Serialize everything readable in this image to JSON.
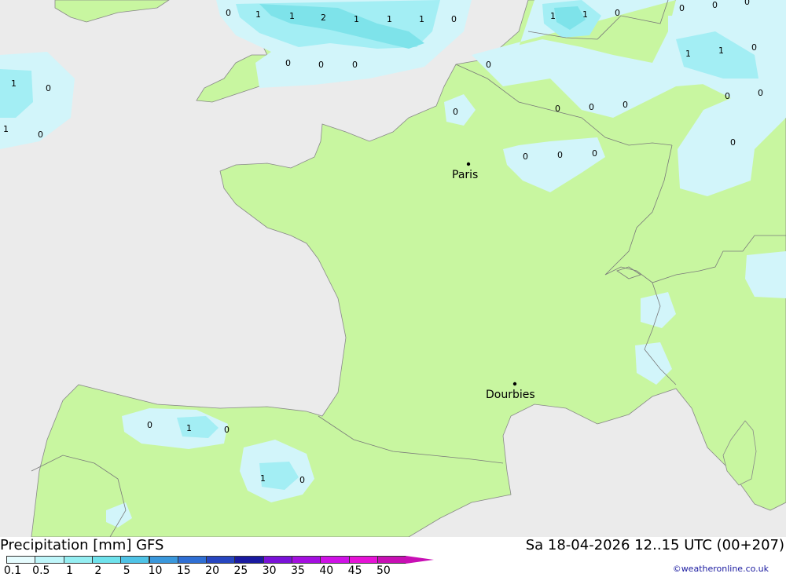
{
  "map": {
    "colors": {
      "sea": "#ebebeb",
      "land": "#c8f6a0",
      "light": "#d2f5fa",
      "mid": "#a3eef4",
      "heavy": "#7ee3ea",
      "border": "#7a7a7a"
    },
    "cities": [
      {
        "name": "Paris",
        "id": "paris"
      },
      {
        "name": "Dourbies",
        "id": "dourbies"
      }
    ],
    "values": [
      "0",
      "1",
      "1",
      "2",
      "1",
      "1",
      "1",
      "0",
      "1",
      "1",
      "0",
      "0",
      "0",
      "0",
      "1",
      "1",
      "0",
      "0",
      "0",
      "0",
      "0",
      "0",
      "0",
      "0",
      "0",
      "0",
      "0",
      "1",
      "0",
      "1",
      "0",
      "0",
      "0",
      "0",
      "0",
      "1",
      "0",
      "1",
      "0",
      "0"
    ]
  },
  "footer": {
    "title": "Precipitation [mm] GFS",
    "datetime": "Sa 18-04-2026 12..15 UTC (00+207)",
    "credit": "©weatheronline.co.uk",
    "legend_labels": [
      "0.1",
      "0.5",
      "1",
      "2",
      "5",
      "10",
      "15",
      "20",
      "25",
      "30",
      "35",
      "40",
      "45",
      "50"
    ],
    "legend_colors": [
      "#e6fcfe",
      "#bff6fa",
      "#95eef2",
      "#6fe2ec",
      "#4fc3e6",
      "#3a98dc",
      "#2f6fd4",
      "#2746c0",
      "#1a1aa0",
      "#7a12d8",
      "#a40fe0",
      "#cf12e6",
      "#e613d6",
      "#c80fb4"
    ]
  }
}
